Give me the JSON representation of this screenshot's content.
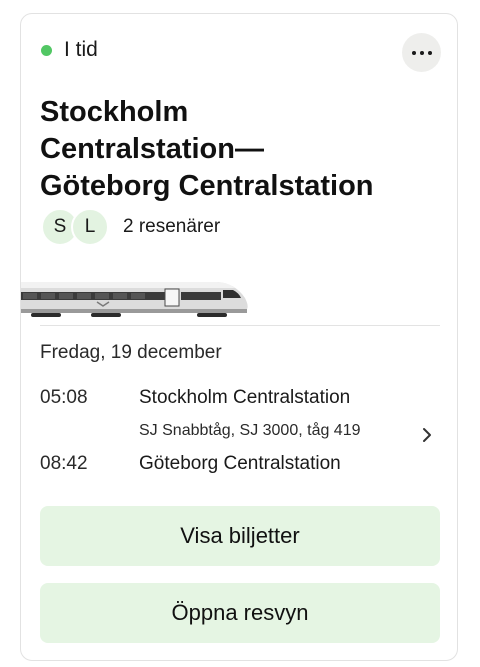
{
  "status": {
    "label": "I tid",
    "color": "#52c764"
  },
  "more_icon": "more-horizontal-icon",
  "trip": {
    "title_lines": [
      "Stockholm",
      "Centralstation—",
      "Göteborg Centralstation"
    ],
    "travelers": {
      "avatars": [
        "S",
        "L"
      ],
      "label": "2 resenärer"
    },
    "date": "Fredag, 19 december",
    "departure": {
      "time": "05:08",
      "station": "Stockholm Centralstation"
    },
    "train_info": "SJ Snabbtåg, SJ 3000, tåg 419",
    "arrival": {
      "time": "08:42",
      "station": "Göteborg Centralstation"
    }
  },
  "buttons": {
    "tickets": "Visa biljetter",
    "journey_view": "Öppna resvyn"
  },
  "colors": {
    "button_bg": "#e5f5e3",
    "avatar_bg": "#e3f3e1"
  }
}
